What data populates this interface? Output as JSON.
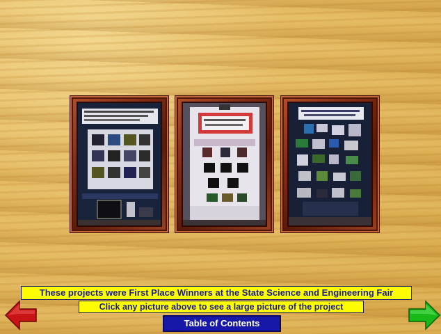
{
  "banners": {
    "headline": "These projects were First Place Winners at the State Science and Engineering Fair",
    "instruction": "Click any picture above to see a large picture of the project"
  },
  "navigation": {
    "toc_label": "Table of Contents",
    "back_icon": "red-left-arrow-icon",
    "forward_icon": "green-right-arrow-icon"
  },
  "colors": {
    "banner_bg": "#fefe00",
    "banner_text": "#1a1a99",
    "button_bg": "#1818a8",
    "back_arrow": "#c81414",
    "forward_arrow": "#18b818"
  }
}
